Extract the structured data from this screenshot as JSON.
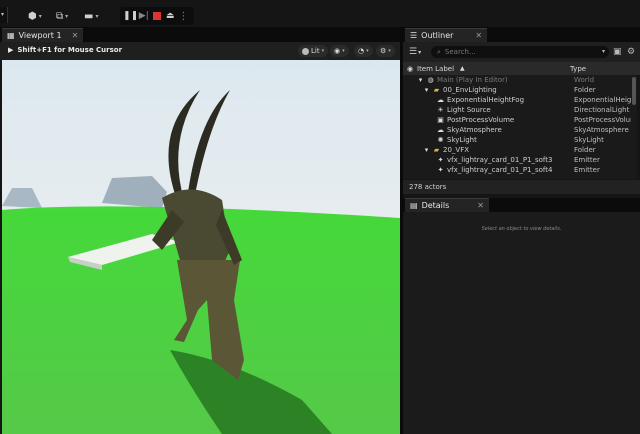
{
  "toolbar": {
    "play_controls": [
      "pause-icon",
      "step-icon",
      "stop-icon",
      "eject-icon",
      "more-icon"
    ]
  },
  "viewport": {
    "tab_title": "Viewport 1",
    "hint": "Shift+F1 for Mouse Cursor",
    "lit_label": "Lit"
  },
  "outliner": {
    "tab_title": "Outliner",
    "search_placeholder": "Search...",
    "col_label": "Item Label",
    "col_type": "Type",
    "rows": [
      {
        "label": "Main (Play In Editor)",
        "type": "World"
      },
      {
        "label": "00_EnvLighting",
        "type": "Folder"
      },
      {
        "label": "ExponentialHeightFog",
        "type": "ExponentialHeightF"
      },
      {
        "label": "Light Source",
        "type": "DirectionalLight"
      },
      {
        "label": "PostProcessVolume",
        "type": "PostProcessVolume"
      },
      {
        "label": "SkyAtmosphere",
        "type": "SkyAtmosphere"
      },
      {
        "label": "SkyLight",
        "type": "SkyLight"
      },
      {
        "label": "20_VFX",
        "type": "Folder"
      },
      {
        "label": "vfx_lightray_card_01_P1_soft3",
        "type": "Emitter"
      },
      {
        "label": "vfx_lightray_card_01_P1_soft4",
        "type": "Emitter"
      }
    ],
    "actor_count": "278 actors"
  },
  "details": {
    "tab_title": "Details",
    "empty_message": "Select an object to view details."
  },
  "colors": {
    "sky": "#dfe9ef",
    "ground": "#4dd43a",
    "stop": "#dd3333",
    "folder": "#d9b14a"
  }
}
